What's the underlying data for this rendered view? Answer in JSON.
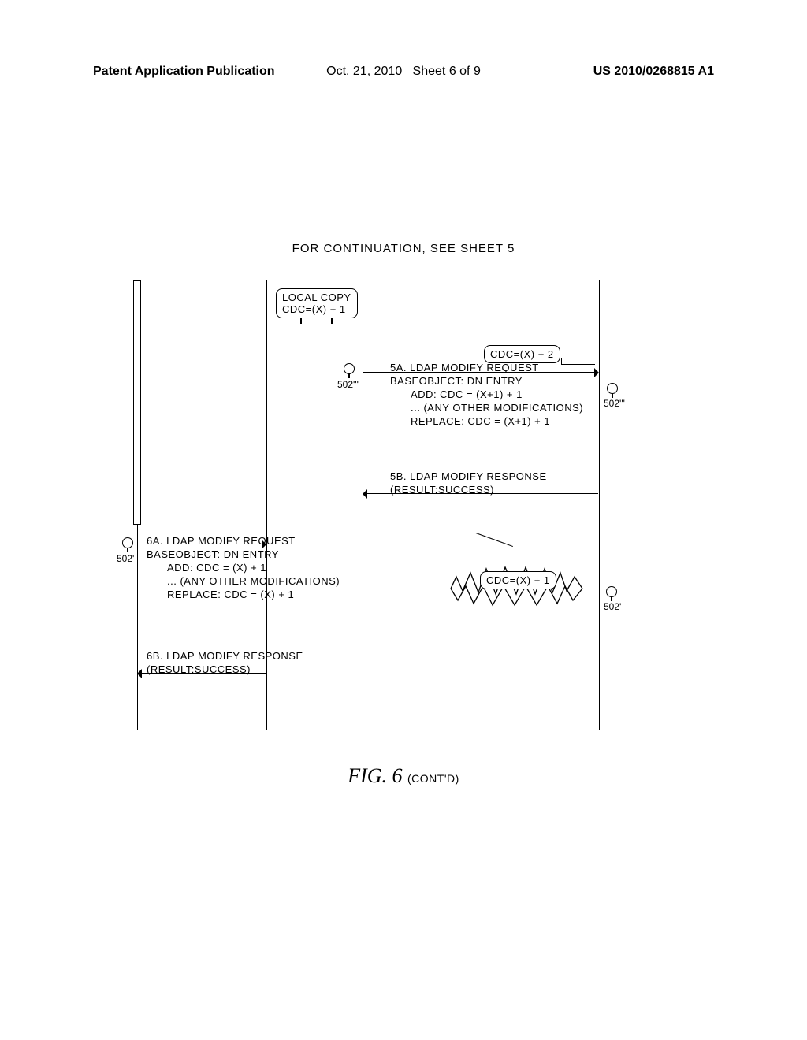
{
  "header": {
    "left": "Patent Application Publication",
    "mid_date": "Oct. 21, 2010",
    "mid_sheet": "Sheet 6 of 9",
    "right": "US 2010/0268815 A1"
  },
  "continuation": "FOR CONTINUATION, SEE SHEET 5",
  "fig_label": "FIG. 6",
  "fig_contd": "(CONT'D)",
  "bubbles": {
    "local_copy_l1": "LOCAL COPY",
    "local_copy_l2": "CDC=(X) + 1",
    "cdc2": "CDC=(X) + 2",
    "cdc1": "CDC=(X) + 1"
  },
  "labels": {
    "l502ppp_a": "502'''",
    "l502ppp_b": "502'''",
    "l502p_a": "502'",
    "l502p_b": "502'"
  },
  "msgs": {
    "m5a": {
      "title": "5A. LDAP MODIFY REQUEST",
      "l1": "BASEOBJECT: DN ENTRY",
      "l2": "ADD: CDC = (X+1) + 1",
      "l3": "... (ANY OTHER MODIFICATIONS)",
      "l4": "REPLACE: CDC = (X+1) + 1"
    },
    "m5b": {
      "title": "5B. LDAP MODIFY RESPONSE",
      "l1": "(RESULT:SUCCESS)"
    },
    "m6a": {
      "title": "6A. LDAP MODIFY REQUEST",
      "l1": "BASEOBJECT: DN ENTRY",
      "l2": "ADD: CDC = (X) + 1",
      "l3": "... (ANY OTHER MODIFICATIONS)",
      "l4": "REPLACE: CDC = (X) + 1"
    },
    "m6b": {
      "title": "6B. LDAP MODIFY RESPONSE",
      "l1": "(RESULT:SUCCESS)"
    }
  }
}
